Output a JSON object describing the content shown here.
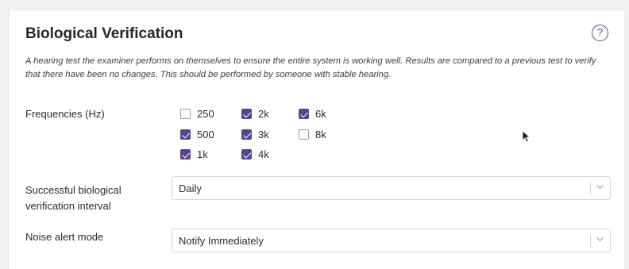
{
  "section": {
    "title": "Biological Verification",
    "help_glyph": "?",
    "description": "A hearing test the examiner performs on themselves to ensure the entire system is working well. Results are compared to a previous test to verify that there have been no changes. This should be performed by someone with stable hearing."
  },
  "frequencies": {
    "label": "Frequencies (Hz)",
    "options": [
      {
        "label": "250",
        "checked": false
      },
      {
        "label": "500",
        "checked": true
      },
      {
        "label": "1k",
        "checked": true
      },
      {
        "label": "2k",
        "checked": true
      },
      {
        "label": "3k",
        "checked": true
      },
      {
        "label": "4k",
        "checked": true
      },
      {
        "label": "6k",
        "checked": true
      },
      {
        "label": "8k",
        "checked": false
      }
    ]
  },
  "interval": {
    "label_line1": "Successful biological",
    "label_line2": "verification interval",
    "value": "Daily"
  },
  "noise_alert": {
    "label": "Noise alert mode",
    "value": "Notify Immediately"
  },
  "colors": {
    "accent": "#55458a",
    "card_bg": "#ffffff",
    "page_bg": "#f1f1f3"
  }
}
